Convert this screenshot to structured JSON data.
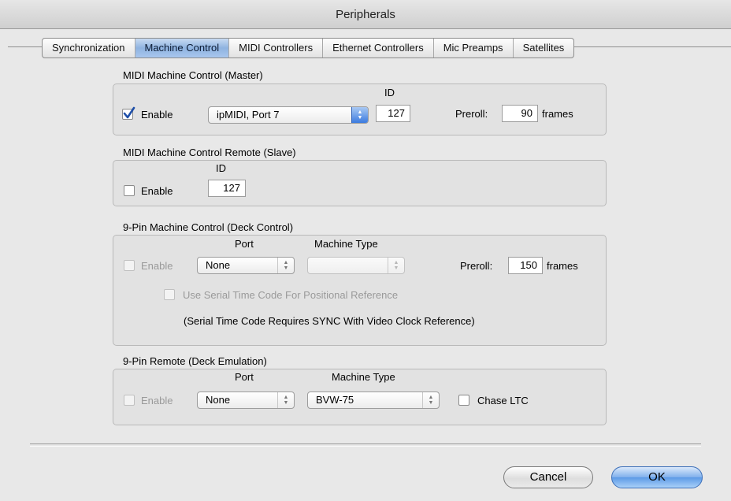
{
  "window": {
    "title": "Peripherals"
  },
  "tabs": [
    {
      "label": "Synchronization"
    },
    {
      "label": "Machine Control",
      "active": true
    },
    {
      "label": "MIDI Controllers"
    },
    {
      "label": "Ethernet Controllers"
    },
    {
      "label": "Mic Preamps"
    },
    {
      "label": "Satellites"
    }
  ],
  "mmc_master": {
    "title": "MIDI Machine Control (Master)",
    "id_header": "ID",
    "enable_label": "Enable",
    "enabled": true,
    "port_value": "ipMIDI, Port 7",
    "id_value": "127",
    "preroll_label": "Preroll:",
    "preroll_value": "90",
    "frames_label": "frames"
  },
  "mmc_remote": {
    "title": "MIDI Machine Control Remote (Slave)",
    "id_header": "ID",
    "enable_label": "Enable",
    "enabled": false,
    "id_value": "127"
  },
  "ninepin_deck": {
    "title": "9-Pin Machine Control (Deck Control)",
    "port_header": "Port",
    "machine_type_header": "Machine Type",
    "enable_label": "Enable",
    "port_value": "None",
    "machine_type_value": "",
    "preroll_label": "Preroll:",
    "preroll_value": "150",
    "frames_label": "frames",
    "serial_tc_label": "Use Serial Time Code For Positional Reference",
    "note": "(Serial Time Code Requires SYNC With Video Clock Reference)"
  },
  "ninepin_remote": {
    "title": "9-Pin Remote (Deck Emulation)",
    "port_header": "Port",
    "machine_type_header": "Machine Type",
    "enable_label": "Enable",
    "port_value": "None",
    "machine_type_value": "BVW-75",
    "chase_ltc_label": "Chase LTC"
  },
  "buttons": {
    "cancel": "Cancel",
    "ok": "OK"
  },
  "colors": {
    "accent": "#3b7be0",
    "tab_active": "#a8c6ee"
  },
  "icons": [
    "checkmark-icon",
    "popup-arrows-icon"
  ]
}
